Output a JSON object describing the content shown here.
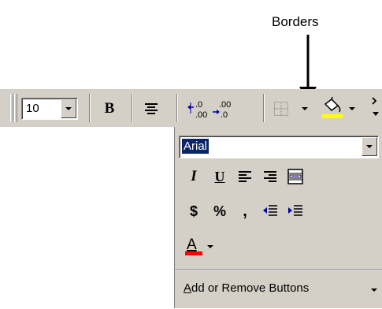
{
  "callout": {
    "label": "Borders"
  },
  "toolbar": {
    "font_size": "10",
    "bold_label": "B"
  },
  "panel": {
    "font_name": "Arial",
    "italic_label": "I",
    "underline_label": "U",
    "currency_label": "$",
    "percent_label": "%",
    "comma_label": ",",
    "font_color_label": "A",
    "add_remove_first_letter": "A",
    "add_remove_rest": "dd or Remove Buttons"
  },
  "colors": {
    "fill_color": "#ffff00",
    "font_color": "#ff0000",
    "selection": "#0a246a",
    "face": "#d4d0c8"
  }
}
